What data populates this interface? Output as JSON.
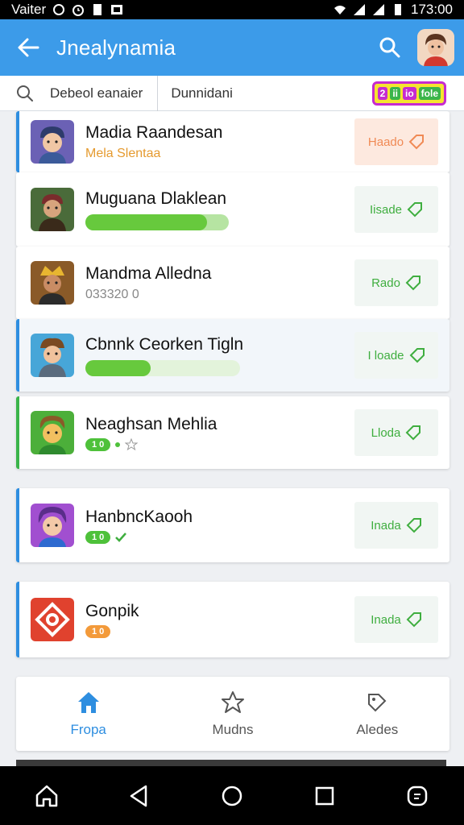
{
  "status_bar": {
    "carrier": "Vaiter",
    "time": "173:00"
  },
  "app_bar": {
    "title": "Jnealynamia",
    "back_icon": "arrow-left-icon",
    "search_icon": "search-icon",
    "avatar_icon": "user-avatar"
  },
  "filter_bar": {
    "search_icon": "search-icon",
    "filter_1": "Debeol eanaier",
    "filter_2": "Dunnidani",
    "badge": [
      "2",
      "ii",
      "io",
      "fole"
    ]
  },
  "items": [
    {
      "name": "Madia Raandesan",
      "subtitle": "Mela Slentaa",
      "action": "Haado",
      "action_icon": "diamond-icon"
    },
    {
      "name": "Muguana Dlaklean",
      "progress": 0.85,
      "action": "Iisade",
      "action_icon": "diamond-icon"
    },
    {
      "name": "Mandma Alledna",
      "subtitle": "033320 0",
      "action": "Rado",
      "action_icon": "diamond-icon"
    },
    {
      "name": "Cbnnk Ceorken Tigln",
      "progress": 0.42,
      "action": "I loade",
      "action_icon": "diamond-icon"
    },
    {
      "name": "Neaghsan Mehlia",
      "tag": "1 0",
      "action": "Lloda",
      "action_icon": "diamond-icon"
    },
    {
      "name": "HanbncKaooh",
      "tag": "1 0",
      "action": "Inada",
      "action_icon": "diamond-icon"
    },
    {
      "name": "Gonpik",
      "tag": "1 0",
      "action": "Inada",
      "action_icon": "diamond-icon"
    }
  ],
  "bottom_nav": [
    {
      "label": "Fropa",
      "icon": "home-icon"
    },
    {
      "label": "Mudns",
      "icon": "star-icon"
    },
    {
      "label": "Aledes",
      "icon": "tag-icon"
    }
  ],
  "colors": {
    "primary": "#3c9be9",
    "accent_green": "#3ab54a",
    "action_green": "#3fae3f",
    "action_orange": "#f08a55"
  }
}
